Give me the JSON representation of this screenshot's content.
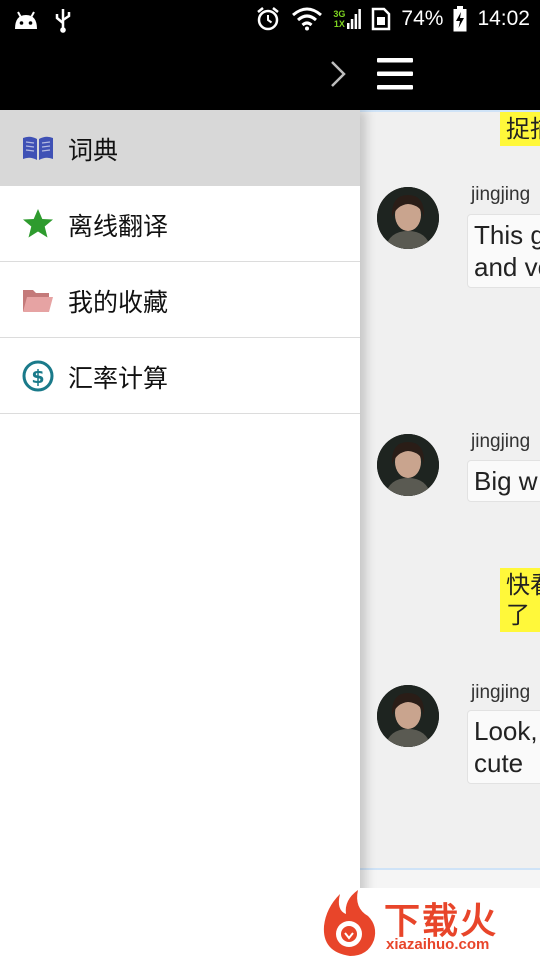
{
  "status_bar": {
    "battery": "74%",
    "time": "14:02",
    "network_top": "3G",
    "network_bottom": "1X"
  },
  "drawer": {
    "items": [
      {
        "label": "词典",
        "icon": "book-icon",
        "color": "#3f51b5",
        "active": true
      },
      {
        "label": "离线翻译",
        "icon": "star-icon",
        "color": "#2e9b2e",
        "active": false
      },
      {
        "label": "我的收藏",
        "icon": "folder-icon",
        "color": "#d98a8a",
        "active": false
      },
      {
        "label": "汇率计算",
        "icon": "dollar-icon",
        "color": "#1a7a8a",
        "active": false
      }
    ]
  },
  "chat": {
    "messages": [
      {
        "type": "self",
        "text": "捉捕"
      },
      {
        "type": "other",
        "user": "jingjing",
        "text_line1": "This g",
        "text_line2": "and vo"
      },
      {
        "type": "other",
        "user": "jingjing",
        "text_line1": "Big w"
      },
      {
        "type": "self",
        "text_line1": "快看",
        "text_line2": "了"
      },
      {
        "type": "other",
        "user": "jingjing",
        "text_line1": "Look,",
        "text_line2": "cute"
      }
    ]
  },
  "watermark": {
    "title": "下载火",
    "site": "xiazaihuo.com"
  },
  "colors": {
    "self_bubble": "#fff83a",
    "watermark": "#e8452a"
  }
}
